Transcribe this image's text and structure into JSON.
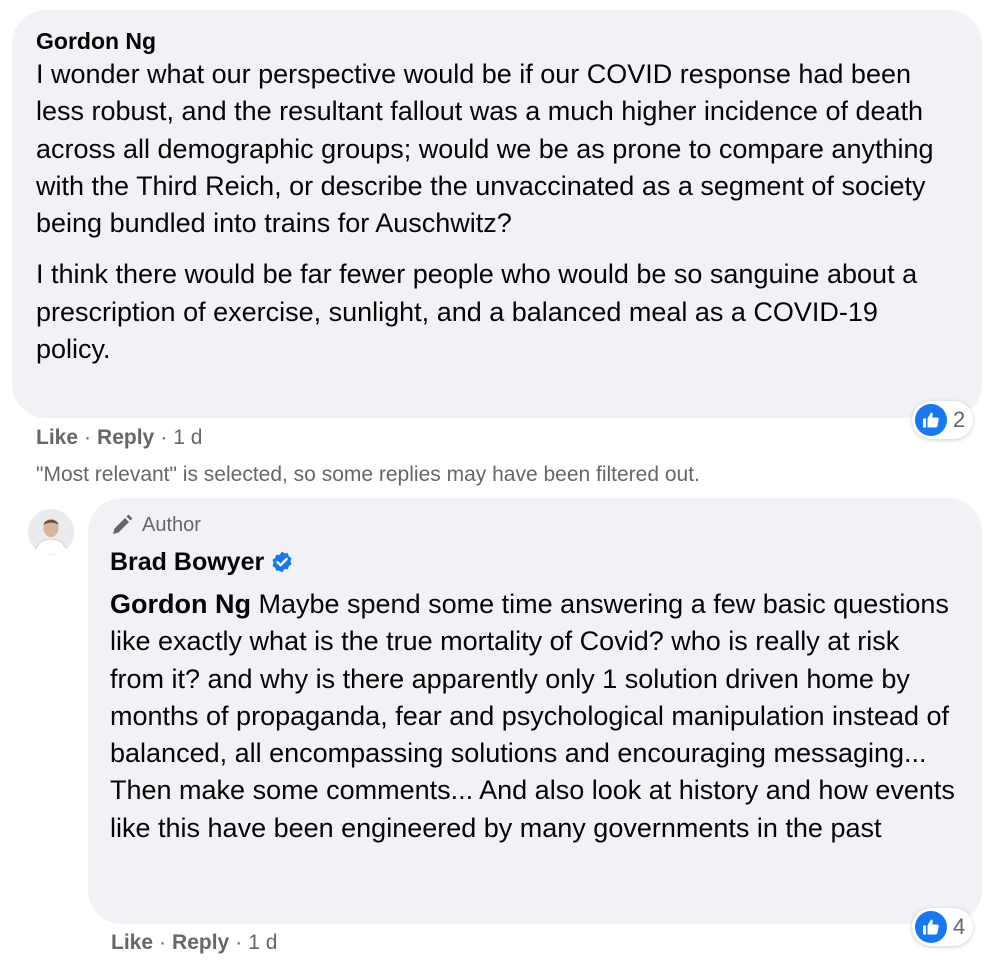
{
  "comment": {
    "author": "Gordon Ng",
    "paragraphs": [
      "I wonder what our perspective would be if our COVID response had been less robust, and the resultant fallout was a much higher incidence of death across all demographic groups; would we be as prone to compare anything with the Third Reich, or describe the unvaccinated as a segment of society being bundled into trains for Auschwitz?",
      "I think there would be far fewer people who would be so sanguine about a prescription of exercise, sunlight, and a balanced meal as a COVID-19 policy."
    ],
    "actions": {
      "like": "Like",
      "reply": "Reply",
      "time": "1 d",
      "separator": "·"
    },
    "reactions": {
      "icon": "thumbs-up-icon",
      "count": "2"
    }
  },
  "filter_note": "\"Most relevant\" is selected, so some replies may have been filtered out.",
  "reply": {
    "author_badge": "Author",
    "author": "Brad Bowyer",
    "verified_icon": "verified-badge-icon",
    "mention": "Gordon Ng",
    "text": " Maybe spend some time answering a few basic questions like exactly what is the true mortality of Covid? who is really at risk from it? and why is there apparently only 1 solution driven home by months of propaganda, fear and psychological manipulation instead of balanced, all encompassing solutions and encouraging messaging... Then make some comments... And also look at history and how events like this have been engineered by many governments in the past",
    "actions": {
      "like": "Like",
      "reply": "Reply",
      "time": "1 d",
      "separator": "·"
    },
    "reactions": {
      "icon": "thumbs-up-icon",
      "count": "4"
    }
  },
  "colors": {
    "bubble": "#f0f2f5",
    "text": "#050505",
    "secondary": "#65676b",
    "brand_blue": "#1877f2"
  }
}
